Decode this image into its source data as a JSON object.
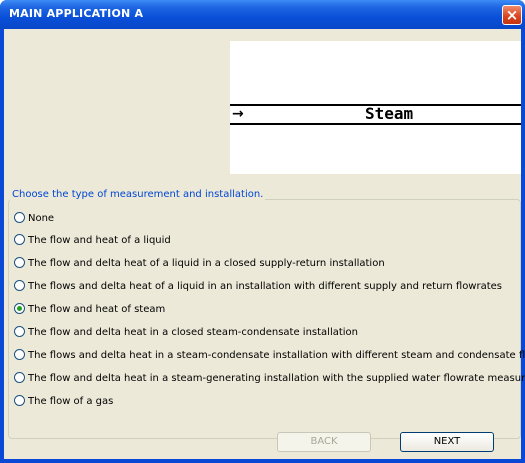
{
  "window": {
    "title": "MAIN APPLICATION A",
    "close_label": "×"
  },
  "preview": {
    "label": "Steam",
    "arrow": "→"
  },
  "group": {
    "legend": "Choose the type of measurement and installation."
  },
  "options": [
    {
      "label": "None",
      "checked": false
    },
    {
      "label": "The flow and heat of a liquid",
      "checked": false
    },
    {
      "label": "The flow and delta heat of a liquid in a closed supply-return installation",
      "checked": false
    },
    {
      "label": "The flows and delta heat of a liquid in an installation with different supply and return flowrates",
      "checked": false
    },
    {
      "label": "The flow and heat of steam",
      "checked": true
    },
    {
      "label": "The flow and delta heat in a closed steam-condensate installation",
      "checked": false
    },
    {
      "label": "The flows and delta heat in a steam-condensate installation with different steam and condensate flowrates",
      "checked": false
    },
    {
      "label": "The flow and delta heat in a steam-generating installation with the supplied water flowrate measured",
      "checked": false
    },
    {
      "label": "The flow of a gas",
      "checked": false
    }
  ],
  "buttons": {
    "back": "BACK",
    "next": "NEXT"
  },
  "colors": {
    "title_bar": "#0a4fd8",
    "close_button": "#d9421d",
    "legend_text": "#0046d5",
    "radio_checked": "#21a121"
  }
}
